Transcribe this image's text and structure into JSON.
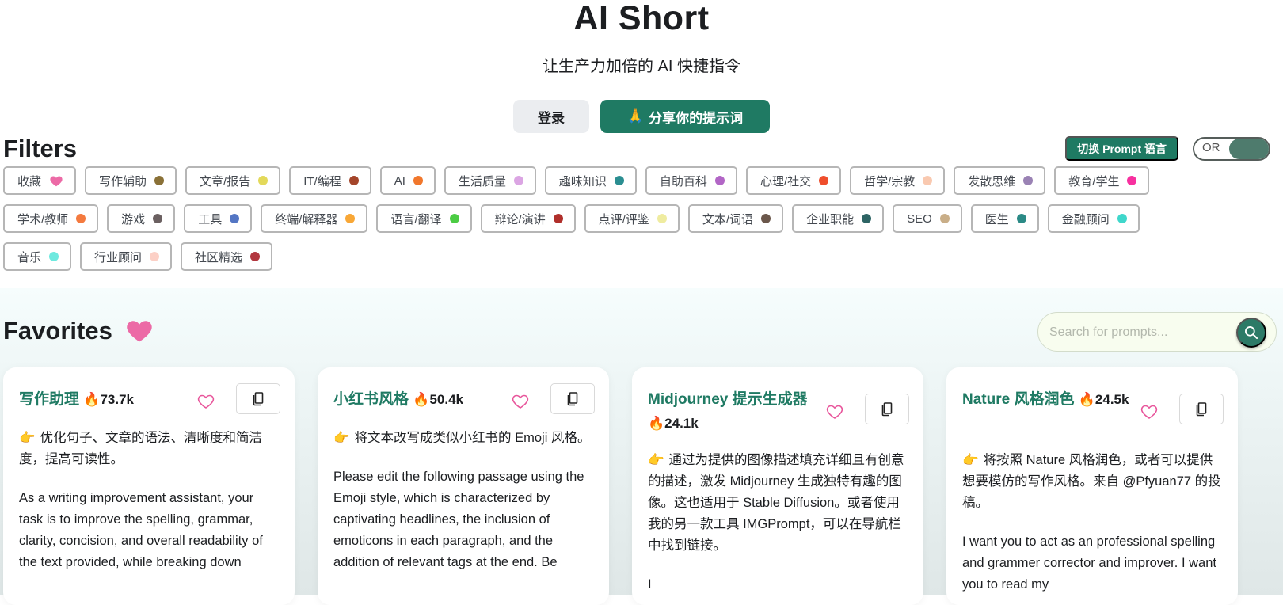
{
  "hero": {
    "title": "AI Short",
    "subtitle": "让生产力加倍的 AI 快捷指令",
    "login_label": "登录",
    "share_emoji": "🙏",
    "share_label": "分享你的提示词"
  },
  "filters": {
    "title": "Filters",
    "lang_button": "切换 Prompt 语言",
    "toggle_label": "OR",
    "tags": [
      {
        "label": "收藏",
        "icon": "heart",
        "color": "#ec6aa6"
      },
      {
        "label": "写作辅助",
        "color": "#8a7137"
      },
      {
        "label": "文章/报告",
        "color": "#e3d95a"
      },
      {
        "label": "IT/编程",
        "color": "#a4452a"
      },
      {
        "label": "AI",
        "color": "#f1772c"
      },
      {
        "label": "生活质量",
        "color": "#dba5e3"
      },
      {
        "label": "趣味知识",
        "color": "#2b8e91"
      },
      {
        "label": "自助百科",
        "color": "#b266c6"
      },
      {
        "label": "心理/社交",
        "color": "#ef4e2c"
      },
      {
        "label": "哲学/宗教",
        "color": "#f9c9b0"
      },
      {
        "label": "发散思维",
        "color": "#9a82b4"
      },
      {
        "label": "教育/学生",
        "color": "#f7309f"
      },
      {
        "label": "学术/教师",
        "color": "#f47a3f"
      },
      {
        "label": "游戏",
        "color": "#6b6061"
      },
      {
        "label": "工具",
        "color": "#5476c4"
      },
      {
        "label": "终端/解释器",
        "color": "#f8a736"
      },
      {
        "label": "语言/翻译",
        "color": "#4ccc44"
      },
      {
        "label": "辩论/演讲",
        "color": "#b02f2b"
      },
      {
        "label": "点评/评鉴",
        "color": "#efeca0"
      },
      {
        "label": "文本/词语",
        "color": "#6b574b"
      },
      {
        "label": "企业职能",
        "color": "#2d6464"
      },
      {
        "label": "SEO",
        "color": "#c9ae88"
      },
      {
        "label": "医生",
        "color": "#2b8a86"
      },
      {
        "label": "金融顾问",
        "color": "#3fd7cb"
      },
      {
        "label": "音乐",
        "color": "#6ee9df"
      },
      {
        "label": "行业顾问",
        "color": "#fcd0c6"
      },
      {
        "label": "社区精选",
        "color": "#b2373f"
      }
    ]
  },
  "favorites": {
    "title": "Favorites",
    "search_placeholder": "Search for prompts...",
    "cards": [
      {
        "title": "写作助理",
        "count": "73.7k",
        "description": "优化句子、文章的语法、清晰度和简洁度，提高可读性。",
        "prompt": "As a writing improvement assistant, your task is to improve the spelling, grammar, clarity, concision, and overall readability of the text provided, while breaking down"
      },
      {
        "title": "小红书风格",
        "count": "50.4k",
        "description": "将文本改写成类似小红书的 Emoji 风格。",
        "prompt": "Please edit the following passage using the Emoji style, which is characterized by captivating headlines, the inclusion of emoticons in each paragraph, and the addition of relevant tags at the end. Be"
      },
      {
        "title": "Midjourney 提示生成器",
        "count": "24.1k",
        "description": "通过为提供的图像描述填充详细且有创意的描述，激发 Midjourney 生成独特有趣的图像。这也适用于 Stable Diffusion。或者使用我的另一款工具 IMGPrompt，可以在导航栏中找到链接。",
        "prompt": "I"
      },
      {
        "title": "Nature 风格润色",
        "count": "24.5k",
        "description": "将按照 Nature 风格润色，或者可以提供想要模仿的写作风格。来自 @Pfyuan77 的投稿。",
        "prompt": "I want you to act as an professional spelling and grammer corrector and improver. I want you to read my"
      }
    ]
  },
  "icons": {
    "fire": "🔥",
    "point": "👉"
  }
}
